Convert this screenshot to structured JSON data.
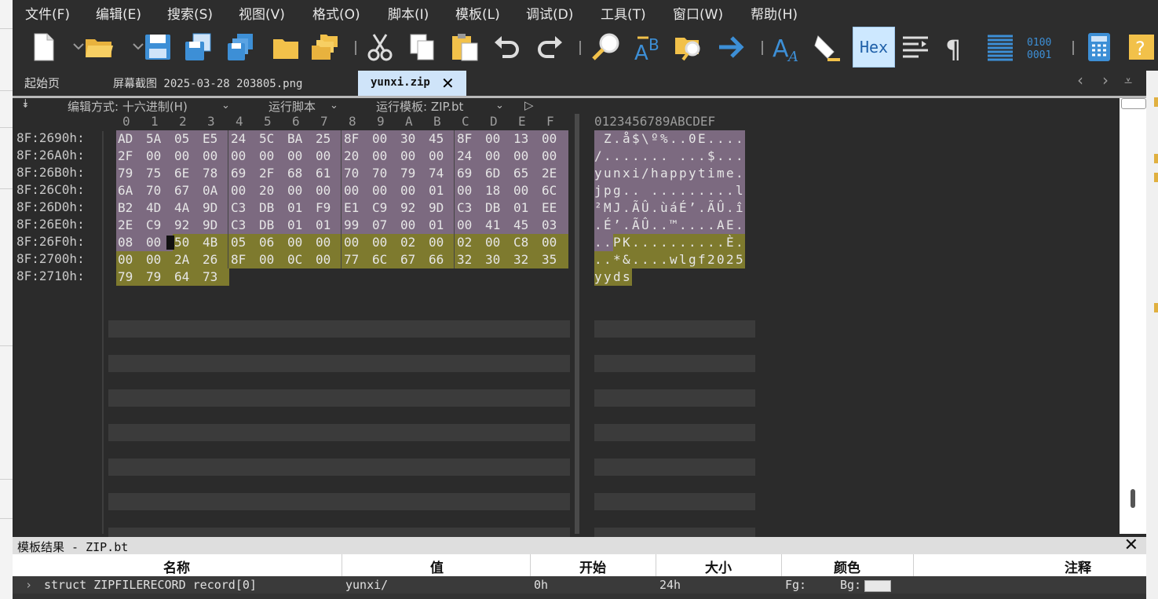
{
  "menu": [
    "文件(F)",
    "编辑(E)",
    "搜索(S)",
    "视图(V)",
    "格式(O)",
    "脚本(I)",
    "模板(L)",
    "调试(D)",
    "工具(T)",
    "窗口(W)",
    "帮助(H)"
  ],
  "toolbar": {
    "hex_label": "Hex",
    "accent": "#3d8fd6",
    "folder_color": "#f2c14a"
  },
  "tabs": {
    "start": "起始页",
    "screenshot": "屏幕截图 2025-03-28 203805.png",
    "active": "yunxi.zip"
  },
  "options": {
    "edit_mode": "编辑方式: 十六进制(H)",
    "run_script": "运行脚本",
    "run_template": "运行模板: ZIP.bt"
  },
  "hex": {
    "col_headers": [
      "0",
      "1",
      "2",
      "3",
      "4",
      "5",
      "6",
      "7",
      "8",
      "9",
      "A",
      "B",
      "C",
      "D",
      "E",
      "F"
    ],
    "ascii_header": "0123456789ABCDEF",
    "rows": [
      {
        "addr": "8F:2690h:",
        "bytes": [
          "AD",
          "5A",
          "05",
          "E5",
          "24",
          "5C",
          "BA",
          "25",
          "8F",
          "00",
          "30",
          "45",
          "8F",
          "00",
          "13",
          "00"
        ],
        "ascii": "­Z.å$\\º%..0E...."
      },
      {
        "addr": "8F:26A0h:",
        "bytes": [
          "2F",
          "00",
          "00",
          "00",
          "00",
          "00",
          "00",
          "00",
          "20",
          "00",
          "00",
          "00",
          "24",
          "00",
          "00",
          "00"
        ],
        "ascii": "/....... ...$..."
      },
      {
        "addr": "8F:26B0h:",
        "bytes": [
          "79",
          "75",
          "6E",
          "78",
          "69",
          "2F",
          "68",
          "61",
          "70",
          "70",
          "79",
          "74",
          "69",
          "6D",
          "65",
          "2E"
        ],
        "ascii": "yunxi/happytime."
      },
      {
        "addr": "8F:26C0h:",
        "bytes": [
          "6A",
          "70",
          "67",
          "0A",
          "00",
          "20",
          "00",
          "00",
          "00",
          "00",
          "00",
          "01",
          "00",
          "18",
          "00",
          "6C"
        ],
        "ascii": "jpg.. .........l"
      },
      {
        "addr": "8F:26D0h:",
        "bytes": [
          "B2",
          "4D",
          "4A",
          "9D",
          "C3",
          "DB",
          "01",
          "F9",
          "E1",
          "C9",
          "92",
          "9D",
          "C3",
          "DB",
          "01",
          "EE"
        ],
        "ascii": "²MJ.ÃÛ.ùáÉ’.ÃÛ.î"
      },
      {
        "addr": "8F:26E0h:",
        "bytes": [
          "2E",
          "C9",
          "92",
          "9D",
          "C3",
          "DB",
          "01",
          "01",
          "99",
          "07",
          "00",
          "01",
          "00",
          "41",
          "45",
          "03"
        ],
        "ascii": ".É’.ÃÛ..™....AE."
      },
      {
        "addr": "8F:26F0h:",
        "bytes": [
          "08",
          "00",
          "50",
          "4B",
          "05",
          "06",
          "00",
          "00",
          "00",
          "00",
          "02",
          "00",
          "02",
          "00",
          "C8",
          "00"
        ],
        "ascii": "..PK..........È."
      },
      {
        "addr": "8F:2700h:",
        "bytes": [
          "00",
          "00",
          "2A",
          "26",
          "8F",
          "00",
          "0C",
          "00",
          "77",
          "6C",
          "67",
          "66",
          "32",
          "30",
          "32",
          "35"
        ],
        "ascii": "..*&....wlgf2025"
      },
      {
        "addr": "8F:2710h:",
        "bytes": [
          "79",
          "79",
          "64",
          "73"
        ],
        "ascii": "yyds"
      }
    ],
    "colors": {
      "purple": "#7c6a80",
      "olive": "#7e7a2e"
    }
  },
  "results": {
    "title": "模板结果 - ZIP.bt",
    "headers": [
      "名称",
      "值",
      "开始",
      "大小",
      "颜色",
      "注释"
    ],
    "row": {
      "name": "struct ZIPFILERECORD record[0]",
      "value": "yunxi/",
      "start": "0h",
      "size": "24h",
      "fg": "Fg:",
      "bg": "Bg:"
    }
  }
}
